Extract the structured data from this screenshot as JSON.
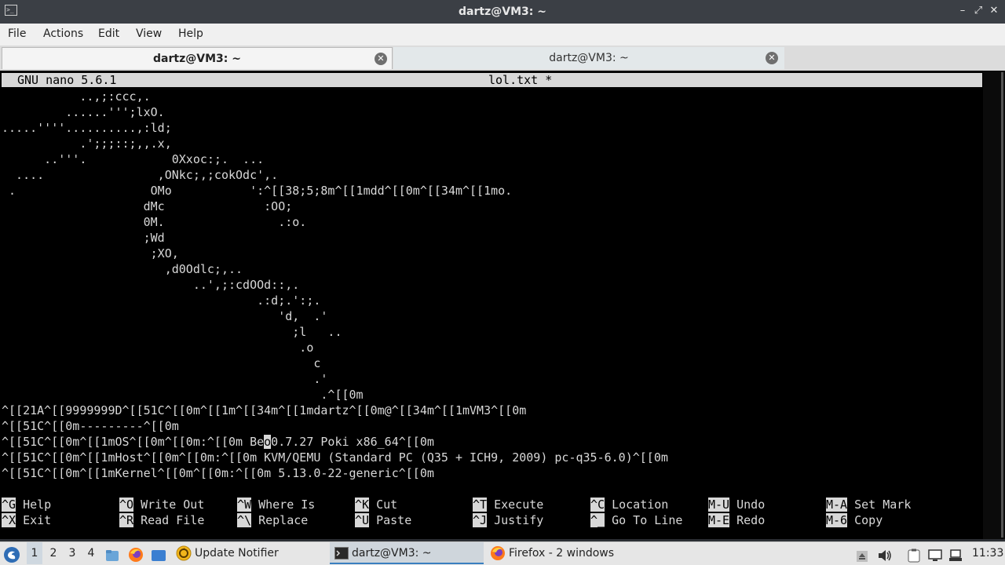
{
  "window": {
    "title": "dartz@VM3: ~",
    "controls": [
      "–",
      "⤢",
      "✕"
    ]
  },
  "menu": [
    "File",
    "Actions",
    "Edit",
    "View",
    "Help"
  ],
  "tabs": [
    {
      "label": "dartz@VM3: ~",
      "active": true
    },
    {
      "label": "dartz@VM3: ~",
      "active": false
    }
  ],
  "nano": {
    "version": "GNU nano 5.6.1",
    "filename": "lol.txt *",
    "lines": [
      "           ..,;:ccc,.",
      "         ......''';lxO.",
      ".....''''..........,:ld;",
      "           .';;;::;,,.x,",
      "      ..'''.            0Xxoc:;.  ...",
      "  ....                ,ONkc;,;cokOdc',.",
      " .                   OMo           ':^[[38;5;8m^[[1mdd^[[0m^[[34m^[[1mo.",
      "                    dMc              :OO;",
      "                    0M.                .:o.",
      "                    ;Wd",
      "                     ;XO,",
      "                       ,d0Odlc;,..",
      "                           ..',;:cdOOd::,.",
      "                                    .:d;.':;.",
      "                                       'd,  .'",
      "                                         ;l   ..",
      "                                          .o",
      "                                            c",
      "                                            .'",
      "                                             .^[[0m",
      "^[[21A^[[9999999D^[[51C^[[0m^[[1m^[[34m^[[1mdartz^[[0m@^[[34m^[[1mVM3^[[0m",
      "^[[51C^[[0m---------^[[0m",
      "^[[51C^[[0m^[[1mOS^[[0m^[[0m:^[[0m Be",
      "^[[51C^[[0m^[[1mHost^[[0m^[[0m:^[[0m KVM/QEMU (Standard PC (Q35 + ICH9, 2009) pc-q35-6.0)^[[0m",
      "^[[51C^[[0m^[[1mKernel^[[0m^[[0m:^[[0m 5.13.0-22-generic^[[0m"
    ],
    "cursor_char": "o",
    "after_cursor": "0.7.27 Poki x86_64^[[0m",
    "shortcuts_row1": [
      {
        "key": "^G",
        "label": "Help"
      },
      {
        "key": "^O",
        "label": "Write Out"
      },
      {
        "key": "^W",
        "label": "Where Is"
      },
      {
        "key": "^K",
        "label": "Cut"
      },
      {
        "key": "^T",
        "label": "Execute"
      },
      {
        "key": "^C",
        "label": "Location"
      },
      {
        "key": "M-U",
        "label": "Undo"
      },
      {
        "key": "M-A",
        "label": "Set Mark"
      }
    ],
    "shortcuts_row2": [
      {
        "key": "^X",
        "label": "Exit"
      },
      {
        "key": "^R",
        "label": "Read File"
      },
      {
        "key": "^\\",
        "label": "Replace"
      },
      {
        "key": "^U",
        "label": "Paste"
      },
      {
        "key": "^J",
        "label": "Justify"
      },
      {
        "key": "^_",
        "label": "Go To Line"
      },
      {
        "key": "M-E",
        "label": "Redo"
      },
      {
        "key": "M-6",
        "label": "Copy"
      }
    ]
  },
  "taskbar": {
    "workspaces": [
      "1",
      "2",
      "3",
      "4"
    ],
    "active_workspace": "1",
    "items": [
      {
        "label": "Update Notifier",
        "icon": "update-notifier-icon"
      },
      {
        "label": "dartz@VM3: ~",
        "icon": "terminal-icon",
        "active": true
      },
      {
        "label": "Firefox - 2 windows",
        "icon": "firefox-icon"
      }
    ],
    "clock": "11:33"
  },
  "colors": {
    "terminal_bg": "#000000",
    "terminal_fg": "#d8d8d8",
    "titlebar_bg": "#3b3f45",
    "accent": "#3a7fc0"
  }
}
